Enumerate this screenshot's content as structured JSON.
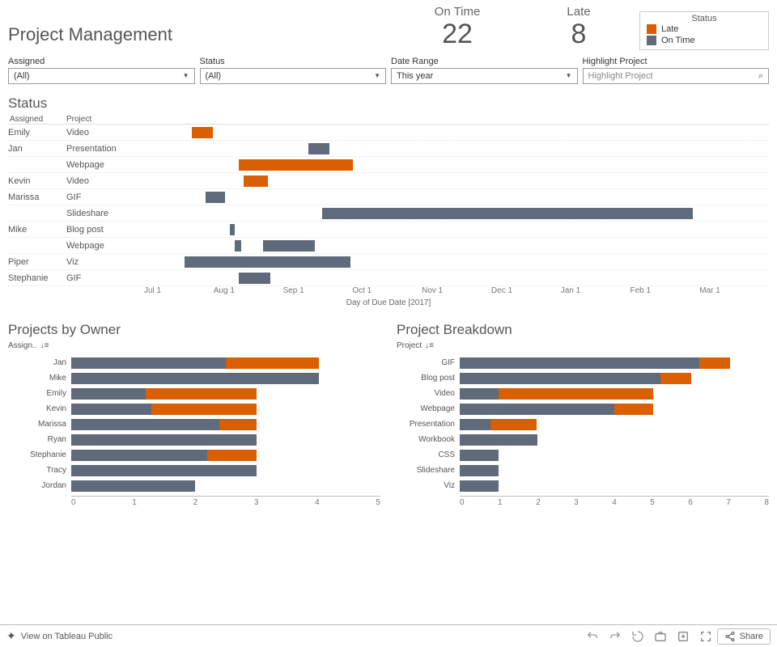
{
  "header": {
    "title": "Project Management",
    "kpi_ontime_label": "On Time",
    "kpi_ontime_value": "22",
    "kpi_late_label": "Late",
    "kpi_late_value": "8",
    "legend_title": "Status",
    "legend_late": "Late",
    "legend_ontime": "On Time"
  },
  "colors": {
    "late": "#d95f02",
    "ontime": "#5f6b7a"
  },
  "filters": {
    "assigned_label": "Assigned",
    "assigned_value": "(All)",
    "status_label": "Status",
    "status_value": "(All)",
    "date_label": "Date Range",
    "date_value": "This year",
    "highlight_label": "Highlight Project",
    "highlight_value": "Highlight Project"
  },
  "gantt": {
    "title": "Status",
    "col1": "Assigned",
    "col2": "Project",
    "caption": "Day of Due Date [2017]",
    "axis": [
      "Jul 1",
      "Aug 1",
      "Sep 1",
      "Oct 1",
      "Nov 1",
      "Dec 1",
      "Jan 1",
      "Feb 1",
      "Mar 1"
    ]
  },
  "owners": {
    "title": "Projects by Owner",
    "sort_label": "Assign.."
  },
  "breakdown": {
    "title": "Project Breakdown",
    "sort_label": "Project"
  },
  "footer": {
    "view_label": "View on Tableau Public",
    "share_label": "Share"
  },
  "chart_data": [
    {
      "type": "bar",
      "name": "Status (Gantt)",
      "xlabel": "Day of Due Date [2017]",
      "x_tick_labels": [
        "Jul 1",
        "Aug 1",
        "Sep 1",
        "Oct 1",
        "Nov 1",
        "Dec 1",
        "Jan 1",
        "Feb 1",
        "Mar 1"
      ],
      "x_range_days_from_jun15": [
        0,
        263
      ],
      "rows": [
        {
          "assigned": "Emily",
          "project": "Video",
          "start": 20,
          "dur": 9,
          "status": "Late"
        },
        {
          "assigned": "Jan",
          "project": "Presentation",
          "start": 69,
          "dur": 9,
          "status": "On Time"
        },
        {
          "assigned": "Jan",
          "project": "Webpage",
          "start": 40,
          "dur": 48,
          "status": "Late"
        },
        {
          "assigned": "Kevin",
          "project": "Video",
          "start": 42,
          "dur": 10,
          "status": "Late"
        },
        {
          "assigned": "Marissa",
          "project": "GIF",
          "start": 26,
          "dur": 8,
          "status": "On Time"
        },
        {
          "assigned": "Marissa",
          "project": "Slideshare",
          "start": 75,
          "dur": 156,
          "status": "On Time"
        },
        {
          "assigned": "Mike",
          "project": "Blog post",
          "start": 36,
          "dur": 2,
          "status": "On Time"
        },
        {
          "assigned": "Mike",
          "project": "Webpage",
          "start": 38,
          "dur": 3,
          "status": "On Time"
        },
        {
          "assigned": "Mike",
          "project": "Webpage",
          "start": 50,
          "dur": 22,
          "status": "On Time"
        },
        {
          "assigned": "Piper",
          "project": "Viz",
          "start": 17,
          "dur": 70,
          "status": "On Time"
        },
        {
          "assigned": "Stephanie",
          "project": "GIF",
          "start": 40,
          "dur": 13,
          "status": "On Time"
        }
      ]
    },
    {
      "type": "bar",
      "name": "Projects by Owner",
      "xlabel": "",
      "ylabel": "",
      "xlim": [
        0,
        5
      ],
      "x_ticks": [
        0,
        1,
        2,
        3,
        4,
        5
      ],
      "categories": [
        "Jan",
        "Mike",
        "Emily",
        "Kevin",
        "Marissa",
        "Ryan",
        "Stephanie",
        "Tracy",
        "Jordan"
      ],
      "series": [
        {
          "name": "On Time",
          "color": "#5f6b7a",
          "values": [
            2.5,
            4.0,
            1.2,
            1.3,
            2.4,
            3.0,
            2.2,
            3.0,
            2.0
          ]
        },
        {
          "name": "Late",
          "color": "#d95f02",
          "values": [
            1.5,
            0.0,
            1.8,
            1.7,
            0.6,
            0.0,
            0.8,
            0.0,
            0.0
          ]
        }
      ],
      "totals": [
        4,
        4,
        3,
        3,
        3,
        3,
        3,
        3,
        2
      ]
    },
    {
      "type": "bar",
      "name": "Project Breakdown",
      "xlabel": "",
      "ylabel": "",
      "xlim": [
        0,
        8
      ],
      "x_ticks": [
        0,
        1,
        2,
        3,
        4,
        5,
        6,
        7,
        8
      ],
      "categories": [
        "GIF",
        "Blog post",
        "Video",
        "Webpage",
        "Presentation",
        "Workbook",
        "CSS",
        "Slideshare",
        "Viz"
      ],
      "series": [
        {
          "name": "On Time",
          "color": "#5f6b7a",
          "values": [
            6.2,
            5.2,
            1.0,
            4.0,
            0.8,
            2.0,
            1.0,
            1.0,
            1.0
          ]
        },
        {
          "name": "Late",
          "color": "#d95f02",
          "values": [
            0.8,
            0.8,
            4.0,
            1.0,
            1.2,
            0.0,
            0.0,
            0.0,
            0.0
          ]
        }
      ],
      "totals": [
        7,
        6,
        5,
        5,
        2,
        2,
        1,
        1,
        1
      ]
    }
  ]
}
